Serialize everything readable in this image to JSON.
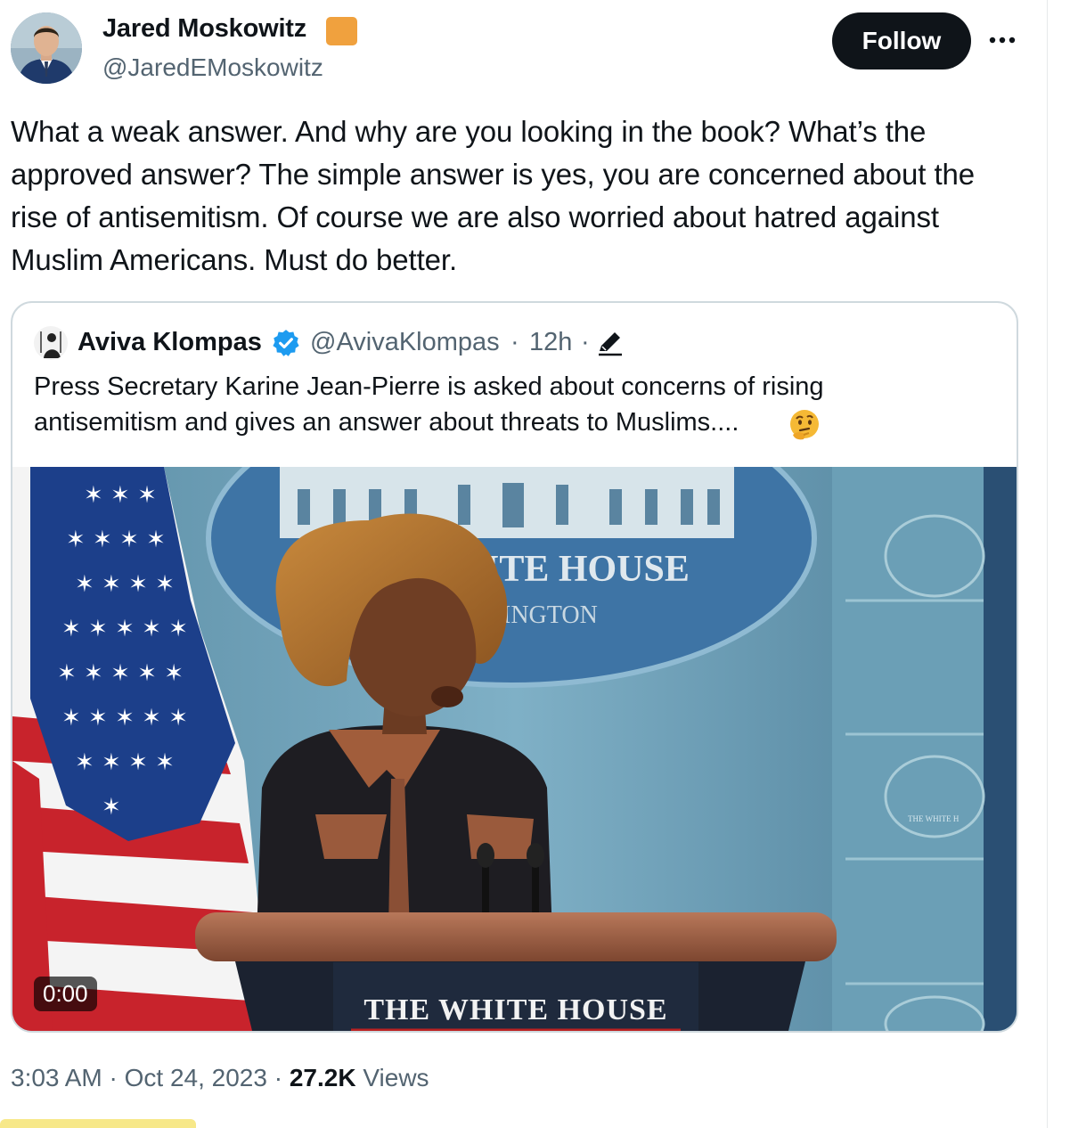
{
  "author": {
    "name": "Jared Moskowitz",
    "handle": "@JaredEMoskowitz",
    "badge_color": "#f0a13e"
  },
  "actions": {
    "follow_label": "Follow",
    "more_icon": "more-icon"
  },
  "tweet": {
    "text": "What a weak answer. And why are you looking in the book? What’s the approved answer? The simple answer is yes, you are concerned about the rise of antisemitism. Of course we are also worried about hatred against Muslim Americans. Must do better."
  },
  "quote": {
    "name": "Aviva Klompas",
    "handle": "@AvivaKlompas",
    "separator": "·",
    "time": "12h",
    "text": "Press Secretary Karine Jean-Pierre is asked about concerns of rising antisemitism and gives an answer about threats to Muslims....",
    "emoji": "thinking-face-icon",
    "verified_color": "#1d9bf0",
    "video": {
      "backdrop_seal_text_line1": "ITE HOUSE",
      "backdrop_seal_text_line2": "INGTON",
      "podium_text": "THE WHITE HOUSE",
      "side_seal_text": "THE WHITE H",
      "timecode": "0:00"
    }
  },
  "meta": {
    "time": "3:03 AM",
    "separator": "·",
    "date": "Oct 24, 2023",
    "views_count": "27.2K",
    "views_label": "Views"
  },
  "colors": {
    "text": "#0f1419",
    "secondary": "#536471",
    "border": "#cfd9de",
    "follow_bg": "#0f1419"
  }
}
